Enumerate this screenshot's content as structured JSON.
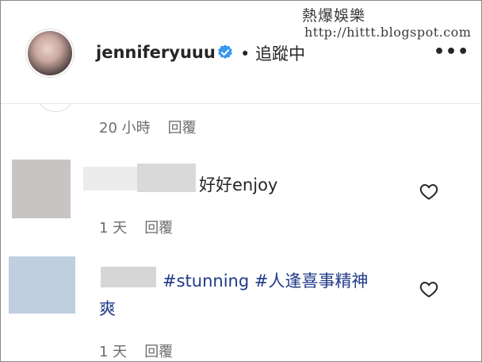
{
  "watermark": {
    "line1": "熱爆娛樂",
    "line2": "http://hittt.blogspot.com"
  },
  "header": {
    "username": "jenniferyuuu",
    "follow_label": "• 追蹤中",
    "more_label": "•••"
  },
  "prev_comment": {
    "time": "20 小時",
    "reply_label": "回覆"
  },
  "comments": [
    {
      "text": "好好enjoy",
      "time": "1 天",
      "reply_label": "回覆"
    },
    {
      "text_line1": "#stunning #人逢喜事精神",
      "text_line2": "爽",
      "time": "1 天",
      "reply_label": "回覆"
    }
  ],
  "colors": {
    "hashtag": "#203a87",
    "verified": "#3897f0",
    "meta": "#6e6e6e"
  },
  "icons": [
    "verified-badge-icon",
    "more-options-icon",
    "heart-icon"
  ]
}
